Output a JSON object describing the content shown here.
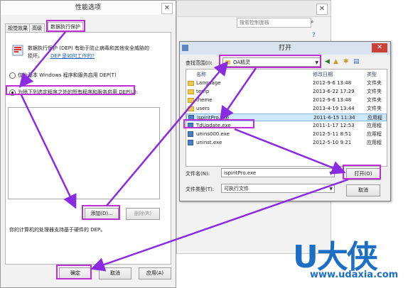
{
  "background_window": {
    "search_placeholder": "搜索控制面板"
  },
  "performance_dialog": {
    "title": "性能选项",
    "tabs": [
      "视觉效果",
      "高级",
      "数据执行保护"
    ],
    "description_line1": "数据执行保护 (DEP) 有助于防止病毒和其他安全威胁的",
    "description_line2": "损坏。",
    "description_link": "DEP 是如何工作的?",
    "option1_label": "仅为基本 Windows 程序和服务启用 DEP(T)",
    "option2_label": "为除下列选定程序之外的所有程序和服务启用 DEP(U):",
    "selected_option": 2,
    "add_button": "添加(D)...",
    "remove_button": "删除(R)",
    "hardware_note": "你的计算机的处理器支持基于硬件的 DEP。",
    "ok_button": "确定",
    "cancel_button": "取消",
    "apply_button": "应用(A)"
  },
  "open_dialog": {
    "title": "打开",
    "look_in_label": "查找范围(I):",
    "look_in_value": "OA精灵",
    "columns": {
      "name": "名称",
      "modified": "修改日期",
      "type": "类型"
    },
    "files": [
      {
        "name": "Language",
        "date": "2012-9-6 13:48",
        "type": "文件夹",
        "kind": "folder"
      },
      {
        "name": "temp",
        "date": "2013-6-22 17:29",
        "type": "文件夹",
        "kind": "folder"
      },
      {
        "name": "theme",
        "date": "2012-9-6 13:48",
        "type": "文件夹",
        "kind": "folder"
      },
      {
        "name": "users",
        "date": "2013-4-19 13:44",
        "type": "文件夹",
        "kind": "folder"
      },
      {
        "name": "ispiritPro.exe",
        "date": "2011-6-15 11:34",
        "type": "应用程",
        "kind": "exe",
        "selected": true
      },
      {
        "name": "TdUpdate.exe",
        "date": "2011-1-17 12:53",
        "type": "应用程",
        "kind": "exe"
      },
      {
        "name": "unins000.exe",
        "date": "2012-5-11 8:51",
        "type": "应用程",
        "kind": "exe"
      },
      {
        "name": "uninst.exe",
        "date": "2012-5-10 9:21",
        "type": "应用程",
        "kind": "exe"
      }
    ],
    "filename_label": "文件名(N):",
    "filename_value": "ispiritPro.exe",
    "filetype_label": "文件类型(T):",
    "filetype_value": "可执行文件",
    "open_button": "打开(O)",
    "cancel_button": "取消",
    "close_glyph": "✕"
  },
  "watermark": {
    "logo": "U大侠",
    "url": "www.udaxia.com"
  },
  "colors": {
    "highlight": "#c02fd6",
    "watermark": "#1d6fc6"
  }
}
